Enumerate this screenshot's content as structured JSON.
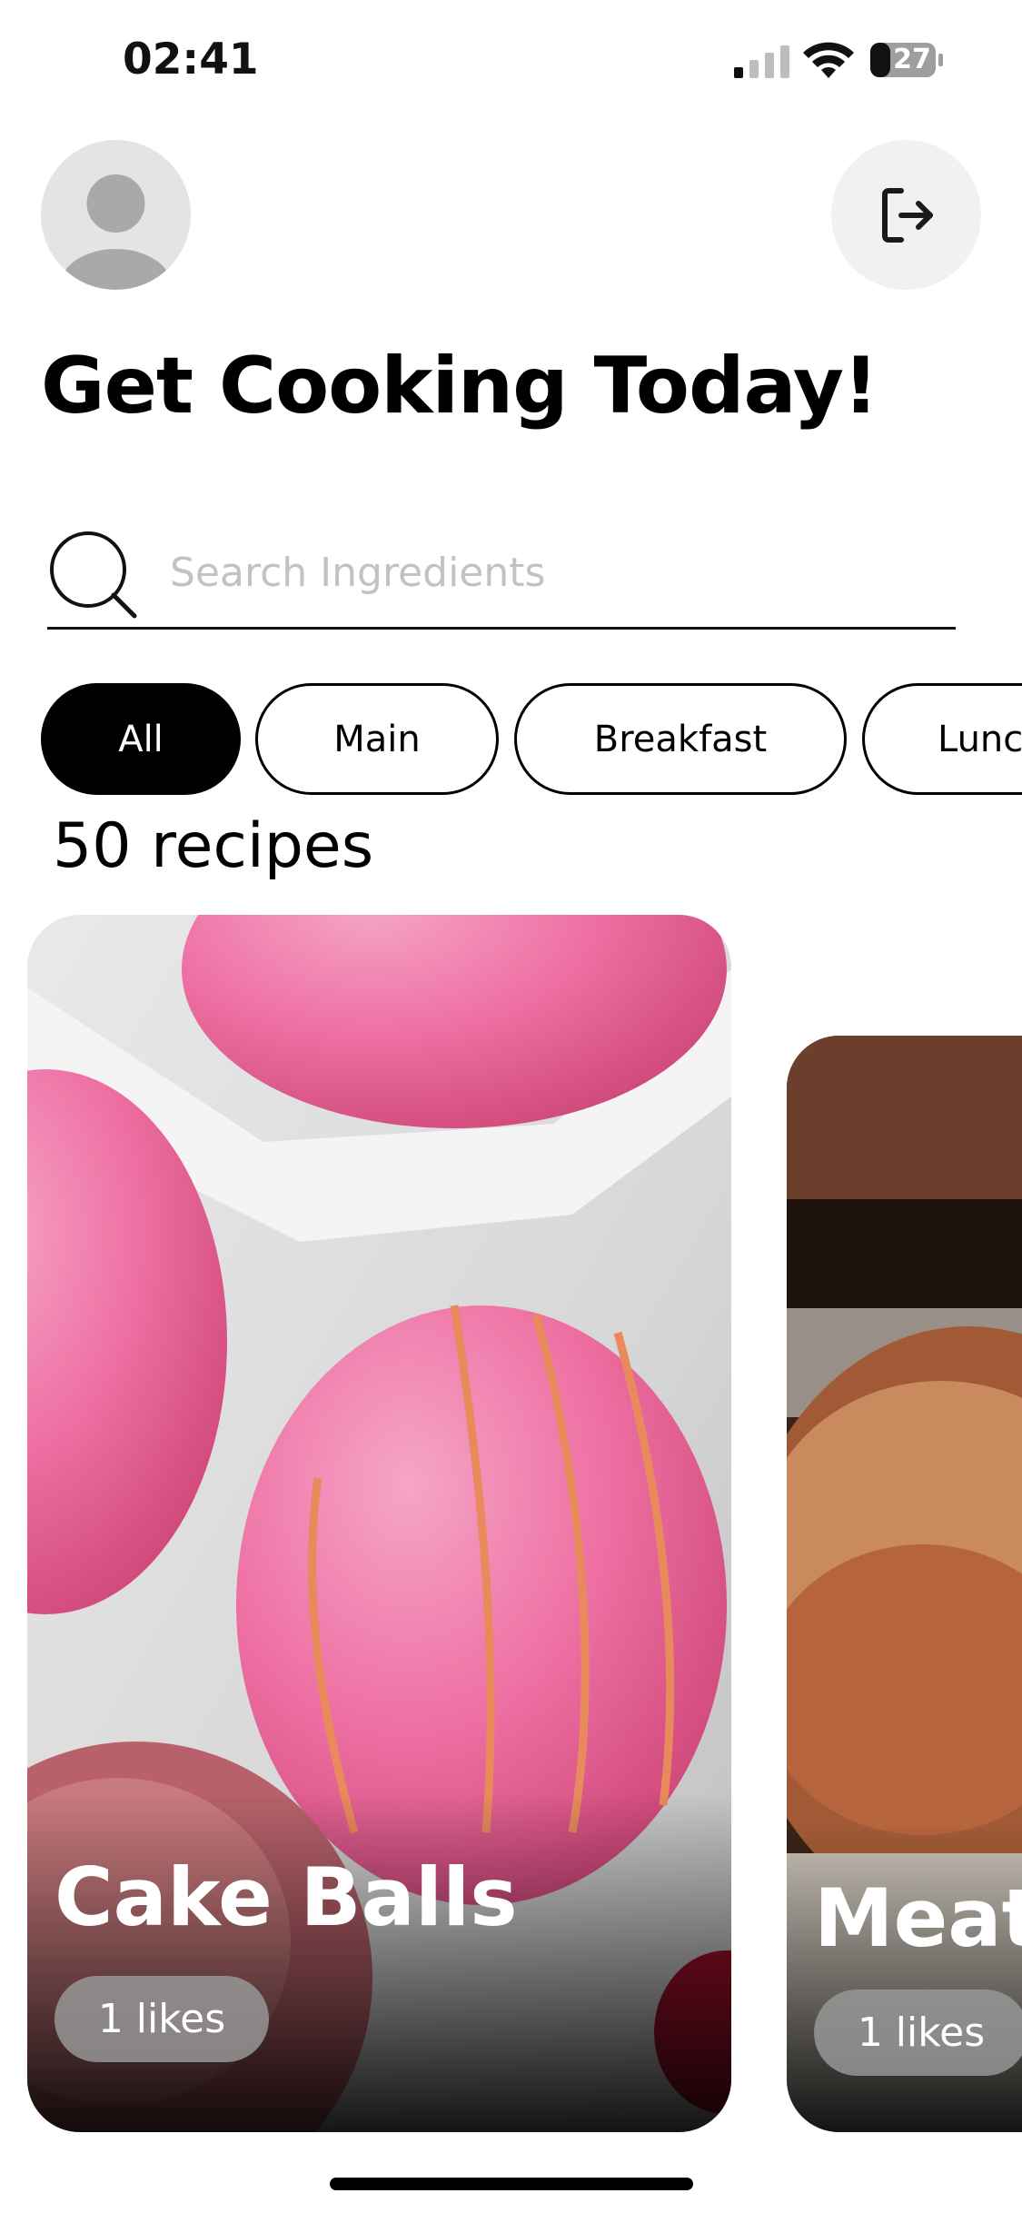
{
  "status_bar": {
    "time": "02:41",
    "battery": "27",
    "icons": [
      "signal-icon",
      "wifi-icon",
      "battery-icon"
    ]
  },
  "header": {
    "avatar_icon": "person-icon",
    "logout_icon": "logout-icon"
  },
  "title": "Get Cooking Today!",
  "search": {
    "placeholder": "Search Ingredients",
    "value": "",
    "icon": "search-icon"
  },
  "categories": [
    {
      "label": "All",
      "active": true
    },
    {
      "label": "Main",
      "active": false
    },
    {
      "label": "Breakfast",
      "active": false
    },
    {
      "label": "Lunch",
      "active": false
    }
  ],
  "recipes_count": "50 recipes",
  "recipes": [
    {
      "title": "Cake Balls",
      "likes": "1 likes"
    },
    {
      "title": "Meatloaf",
      "likes": "1 likes"
    }
  ],
  "colors": {
    "accent": "#000000",
    "background": "#ffffff",
    "chip_inactive_bg": "#ffffff",
    "placeholder": "#c2c2c2",
    "likes_pill": "#969696"
  }
}
